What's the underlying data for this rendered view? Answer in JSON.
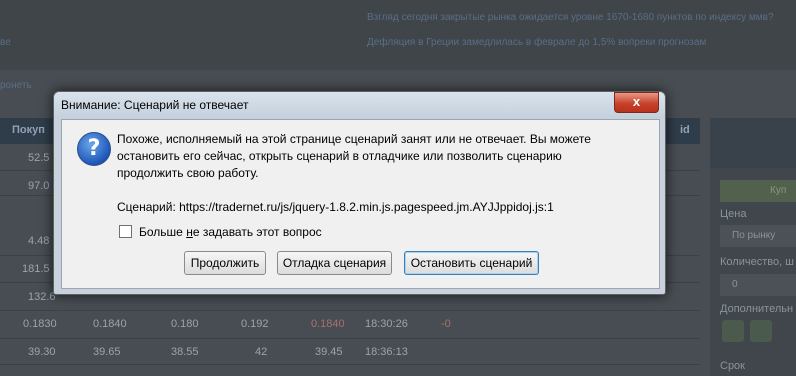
{
  "background": {
    "news": [
      "Взгляд сегодня закрытые рынка ожидается уровне 1670-1680 пунктов по индексу ммв?",
      "Дефляция в Греции замедлилась в феврале до 1,5% вопреки прогнозам"
    ],
    "left_fragments": [
      "ве",
      "ронеть"
    ],
    "table_header": [
      "Покуп",
      "id"
    ],
    "rows": [
      [
        "52.5",
        "",
        "",
        "",
        "",
        "",
        ""
      ],
      [
        "97.0",
        "",
        "",
        "",
        "",
        "",
        ""
      ],
      [
        "4.48",
        "",
        "",
        "",
        "",
        "",
        ""
      ],
      [
        "181.5",
        "",
        "",
        "",
        "",
        "",
        ""
      ],
      [
        "132.6",
        "",
        "",
        "",
        "",
        "",
        ""
      ],
      [
        "0.1830",
        "0.1840",
        "0.180",
        "0.192",
        "0.1840",
        "18:30:26",
        "-0"
      ],
      [
        "39.30",
        "39.65",
        "38.55",
        "42",
        "39.45",
        "18:36:13",
        ""
      ]
    ],
    "panel": {
      "green_button": "Куп",
      "price_label": "Цена",
      "price_value": "По рынку",
      "qty_label": "Количество, ш",
      "qty_value": "0",
      "extra_label": "Дополнительн",
      "term_label": "Срок"
    }
  },
  "dialog": {
    "title": "Внимание: Сценарий не отвечает",
    "close_symbol": "x",
    "icon": "question-icon",
    "message": "Похоже, исполняемый на этой странице сценарий занят или не отвечает. Вы можете остановить его сейчас, открыть сценарий в отладчике или позволить сценарию продолжить свою работу.",
    "script": "Сценарий: https://tradernet.ru/js/jquery-1.8.2.min.js.pagespeed.jm.AYJJppidoj.js:1",
    "checkbox_pre": "Больше ",
    "checkbox_u": "н",
    "checkbox_post": "е задавать этот вопрос",
    "buttons": {
      "continue": "Продолжить",
      "debug": "Отладка сценария",
      "stop": "Остановить сценарий"
    }
  }
}
